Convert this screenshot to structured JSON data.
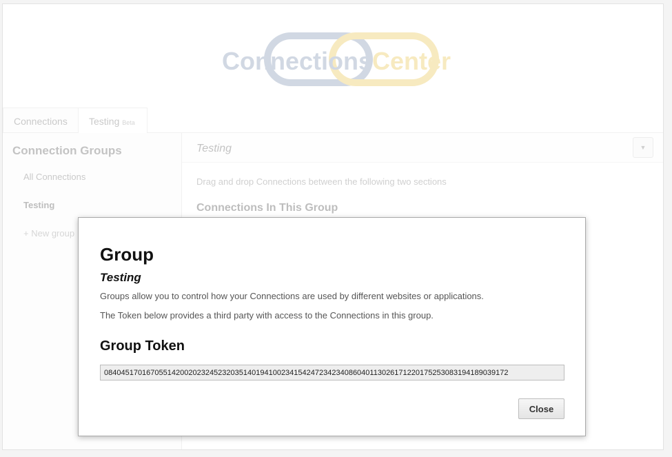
{
  "app": {
    "logo": {
      "part1": "Connections",
      "part2": "Center",
      "colors": {
        "part1": "#7b8fae",
        "part2": "#e9c34a"
      }
    },
    "tabs": [
      {
        "label": "Connections",
        "badge": ""
      },
      {
        "label": "Testing",
        "badge": "Beta"
      }
    ],
    "sidebar": {
      "title": "Connection Groups",
      "items": [
        "All Connections",
        "Testing",
        "+ New group"
      ]
    },
    "main": {
      "title": "Testing",
      "dropdown_icon": "caret-down-icon",
      "hint": "Drag and drop Connections between the following two sections",
      "section_title": "Connections In This Group"
    }
  },
  "modal": {
    "title": "Group",
    "subtitle": "Testing",
    "paragraph1": "Groups allow you to control how your Connections are used by different websites or applications.",
    "paragraph2": "The Token below provides a third party with access to the Connections in this group.",
    "token_title": "Group Token",
    "token_value": "084045170167055142002023245232035140194100234154247234234086040113026171220175253083194189039172",
    "close_label": "Close"
  }
}
